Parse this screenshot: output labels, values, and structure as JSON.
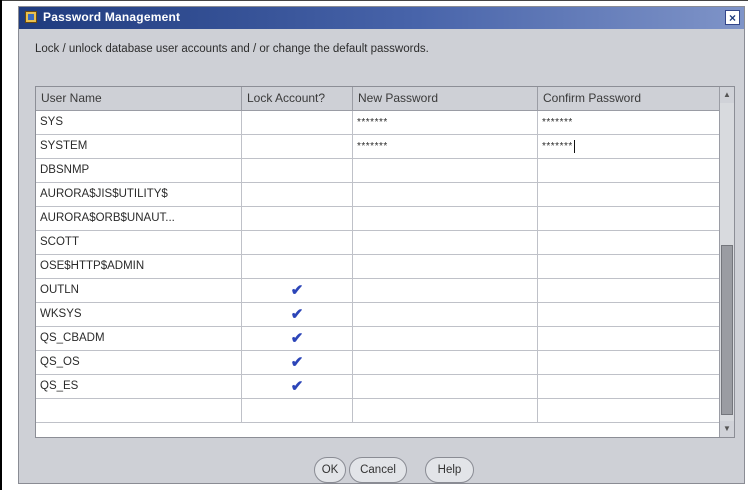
{
  "dialog": {
    "title": "Password Management",
    "close_label": "×",
    "instruction": "Lock / unlock database user accounts and / or change the default passwords."
  },
  "table": {
    "columns": [
      "User Name",
      "Lock Account?",
      "New Password",
      "Confirm Password"
    ],
    "rows": [
      {
        "user": "SYS",
        "locked": false,
        "new_password": "*******",
        "confirm_password": "*******"
      },
      {
        "user": "SYSTEM",
        "locked": false,
        "new_password": "*******",
        "confirm_password": "*******"
      },
      {
        "user": "DBSNMP",
        "locked": false,
        "new_password": "",
        "confirm_password": ""
      },
      {
        "user": "AURORA$JIS$UTILITY$",
        "locked": false,
        "new_password": "",
        "confirm_password": ""
      },
      {
        "user": "AURORA$ORB$UNAUT...",
        "locked": false,
        "new_password": "",
        "confirm_password": ""
      },
      {
        "user": "SCOTT",
        "locked": false,
        "new_password": "",
        "confirm_password": ""
      },
      {
        "user": "OSE$HTTP$ADMIN",
        "locked": false,
        "new_password": "",
        "confirm_password": ""
      },
      {
        "user": "OUTLN",
        "locked": true,
        "new_password": "",
        "confirm_password": ""
      },
      {
        "user": "WKSYS",
        "locked": true,
        "new_password": "",
        "confirm_password": ""
      },
      {
        "user": "QS_CBADM",
        "locked": true,
        "new_password": "",
        "confirm_password": ""
      },
      {
        "user": "QS_OS",
        "locked": true,
        "new_password": "",
        "confirm_password": ""
      },
      {
        "user": "QS_ES",
        "locked": true,
        "new_password": "",
        "confirm_password": ""
      },
      {
        "user": "",
        "locked": false,
        "new_password": "",
        "confirm_password": ""
      }
    ],
    "check_glyph": "✔"
  },
  "scrollbar": {
    "up_glyph": "▲",
    "down_glyph": "▼"
  },
  "buttons": {
    "ok": "OK",
    "cancel": "Cancel",
    "help": "Help"
  },
  "colors": {
    "titlebar": "#1f3b7e",
    "check": "#2c45b8",
    "dialog_bg": "#ced0d6"
  }
}
